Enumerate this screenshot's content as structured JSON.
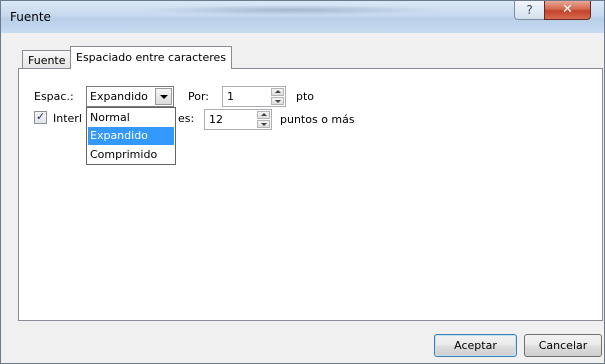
{
  "window": {
    "title": "Fuente",
    "help_glyph": "?",
    "close_glyph": "✕"
  },
  "tabs": {
    "fuente": "Fuente",
    "espaciado": "Espaciado entre caracteres"
  },
  "spacing": {
    "label": "Espac.:",
    "value": "Expandido",
    "options": [
      "Normal",
      "Expandido",
      "Comprimido"
    ],
    "selected_index": 1,
    "por_label": "Por:",
    "por_value": "1",
    "unit": "pto"
  },
  "kerning": {
    "checked": true,
    "label_visible": "Interl",
    "label_tail": "es:",
    "value": "12",
    "suffix": "puntos o más"
  },
  "buttons": {
    "ok": "Aceptar",
    "cancel": "Cancelar"
  },
  "colors": {
    "selection": "#3399ff",
    "close_button": "#c2432a"
  }
}
